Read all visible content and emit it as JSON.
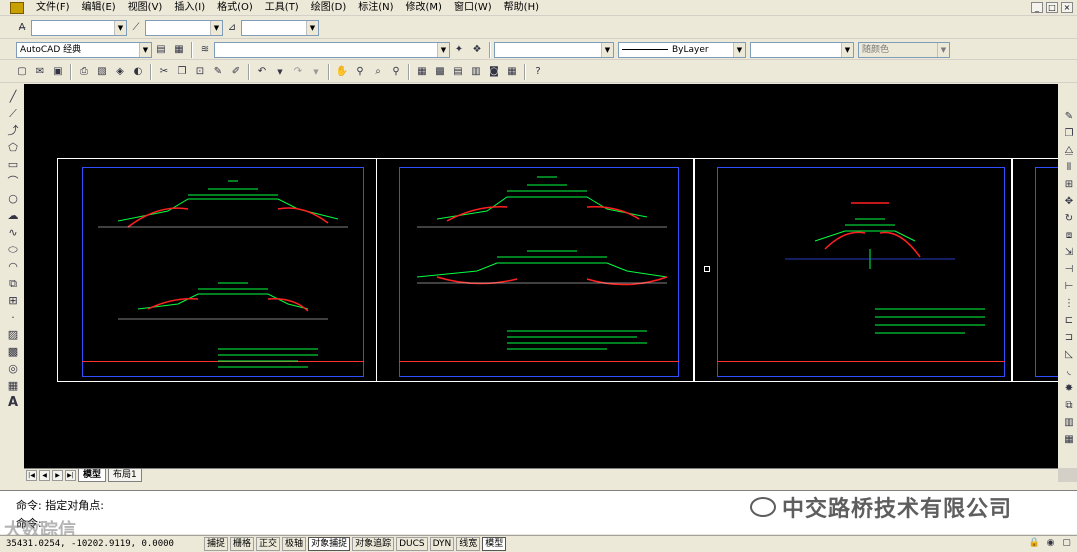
{
  "menu": {
    "items": [
      "文件(F)",
      "编辑(E)",
      "视图(V)",
      "插入(I)",
      "格式(O)",
      "工具(T)",
      "绘图(D)",
      "标注(N)",
      "修改(M)",
      "窗口(W)",
      "帮助(H)"
    ]
  },
  "toolbar2": {
    "workspace": "AutoCAD 经典",
    "linetype": "ByLayer",
    "color": "随颜色"
  },
  "tabs": {
    "model": "模型",
    "layout1": "布局1"
  },
  "command": {
    "history": "命令:  指定对角点:",
    "prompt": "命令:"
  },
  "status": {
    "coords": "35431.0254, -10202.9119, 0.0000",
    "modes": [
      {
        "label": "捕捉",
        "on": false
      },
      {
        "label": "栅格",
        "on": false
      },
      {
        "label": "正交",
        "on": false
      },
      {
        "label": "极轴",
        "on": false
      },
      {
        "label": "对象捕捉",
        "on": true
      },
      {
        "label": "对象追踪",
        "on": false
      },
      {
        "label": "DUCS",
        "on": false
      },
      {
        "label": "DYN",
        "on": false
      },
      {
        "label": "线宽",
        "on": false
      },
      {
        "label": "模型",
        "on": true
      }
    ]
  },
  "watermarks": {
    "company": "中交路桥技术有限公司",
    "bottom": "大数踪信"
  },
  "colors": {
    "background": "#000000",
    "frame": "#3050ff",
    "title_line": "#ff3030",
    "drawing_green": "#00ff40",
    "drawing_red": "#ff2020"
  }
}
